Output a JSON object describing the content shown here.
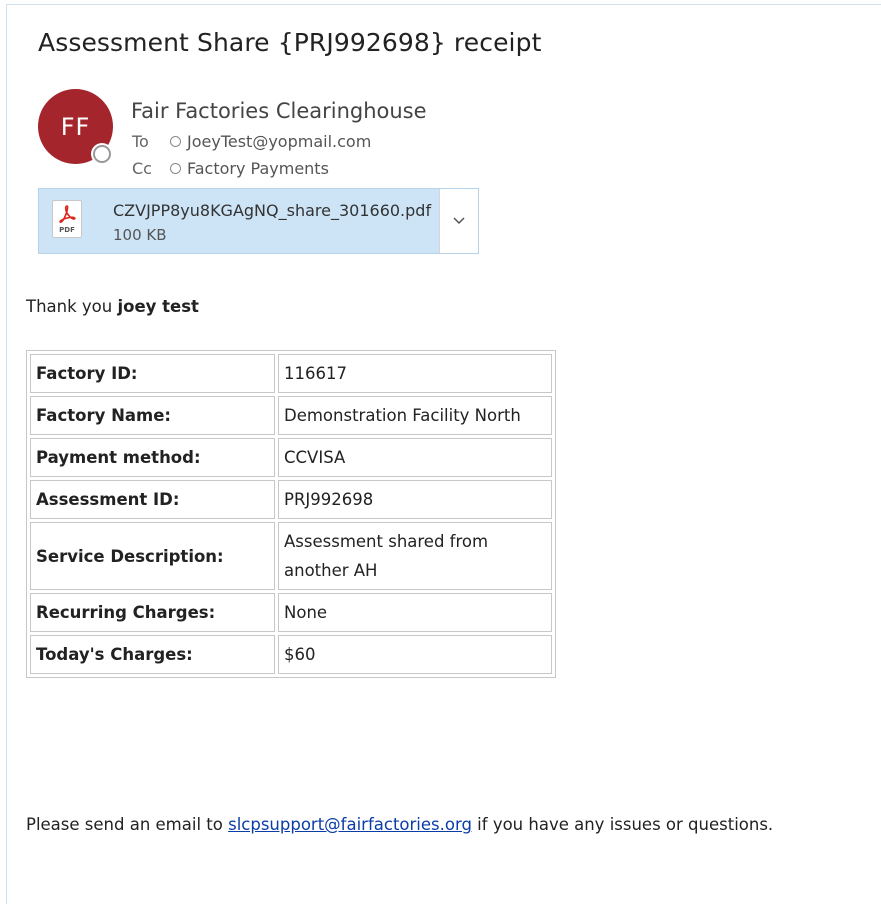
{
  "email": {
    "subject": "Assessment Share {PRJ992698} receipt",
    "sender": {
      "initials": "FF",
      "name": "Fair Factories Clearinghouse",
      "avatar_color": "#a4262c"
    },
    "to_label": "To",
    "to_value": "JoeyTest@yopmail.com",
    "cc_label": "Cc",
    "cc_value": "Factory Payments",
    "attachment": {
      "filename": "CZVJPP8yu8KGAgNQ_share_301660.pdf",
      "size": "100 KB",
      "icon": "pdf-icon",
      "icon_text": "PDF"
    }
  },
  "body": {
    "thanks_prefix": "Thank you ",
    "thanks_name": "joey test",
    "rows": [
      {
        "label": "Factory ID:",
        "value": "116617"
      },
      {
        "label": "Factory Name:",
        "value": "Demonstration Facility North"
      },
      {
        "label": "Payment method:",
        "value": "CCVISA"
      },
      {
        "label": "Assessment ID:",
        "value": "PRJ992698"
      },
      {
        "label": "Service Description:",
        "value": "Assessment shared from another AH"
      },
      {
        "label": "Recurring Charges:",
        "value": "None"
      },
      {
        "label": "Today's Charges:",
        "value": "$60"
      }
    ],
    "footer_prefix": "Please send an email to ",
    "footer_link": "slcpsupport@fairfactories.org",
    "footer_suffix": " if you have any issues or questions."
  }
}
